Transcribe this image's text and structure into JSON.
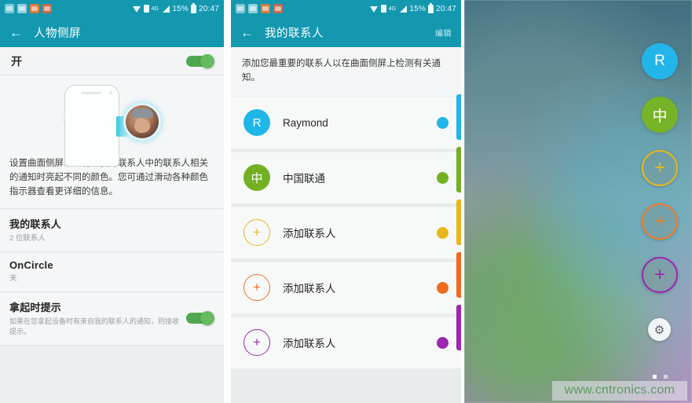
{
  "statusbar": {
    "notification_icons": [
      "message-icon",
      "mail-icon",
      "app-orange-icon",
      "app-red-icon"
    ],
    "wifi": "wifi-icon",
    "sim": "sim-icon",
    "network": "4G",
    "signal": "signal-icon",
    "battery_percent": "15%",
    "battery": "battery-icon",
    "time": "20:47"
  },
  "screen1": {
    "back": "←",
    "title": "人物侧屏",
    "master_toggle_label": "开",
    "master_toggle_on": true,
    "description": "设置曲面侧屏以在有与我的联系人中的联系人相关的通知时亮起不同的颜色。您可通过滑动各种颜色指示器查看更详细的信息。",
    "rows": [
      {
        "title": "我的联系人",
        "sub": "2 位联系人",
        "toggle": false
      },
      {
        "title": "OnCircle",
        "sub": "关",
        "toggle": false
      },
      {
        "title": "拿起时提示",
        "sub": "如果在您拿起设备时有来自我的联系人的通知，则接收提示。",
        "toggle": true
      }
    ]
  },
  "screen2": {
    "back": "←",
    "title": "我的联系人",
    "edit_label": "编辑",
    "description": "添加您最重要的联系人以在曲面侧屏上检测有关通知。",
    "contacts": [
      {
        "initial": "R",
        "name": "Raymond",
        "avatar_color": "#1fb6e8",
        "dot_color": "#1fb6e8",
        "is_add": false
      },
      {
        "initial": "中",
        "name": "中国联通",
        "avatar_color": "#73b023",
        "dot_color": "#73b023",
        "is_add": false
      },
      {
        "initial": "+",
        "name": "添加联系人",
        "avatar_color": "#e3b81d",
        "dot_color": "#e8b71a",
        "is_add": true
      },
      {
        "initial": "+",
        "name": "添加联系人",
        "avatar_color": "#ee7325",
        "dot_color": "#f06a20",
        "is_add": true
      },
      {
        "initial": "+",
        "name": "添加联系人",
        "avatar_color": "#9c27b0",
        "dot_color": "#9c27b0",
        "is_add": true
      }
    ],
    "edge_strips": [
      "#1fb6e8",
      "#73b023",
      "#e8b71a",
      "#f06a20",
      "#9c27b0"
    ]
  },
  "screen3": {
    "edge_items": [
      {
        "initial": "R",
        "color": "#22b5e9",
        "is_add": false
      },
      {
        "initial": "中",
        "color": "#77b327",
        "is_add": false
      },
      {
        "initial": "+",
        "color": "#e8b71a",
        "is_add": true
      },
      {
        "initial": "+",
        "color": "#ee7d2b",
        "is_add": true
      },
      {
        "initial": "+",
        "color": "#9c27b0",
        "is_add": true
      }
    ],
    "settings_icon": "⚙",
    "page_dots": 2,
    "active_dot": 0,
    "watermark": "www.cntronics.com"
  }
}
